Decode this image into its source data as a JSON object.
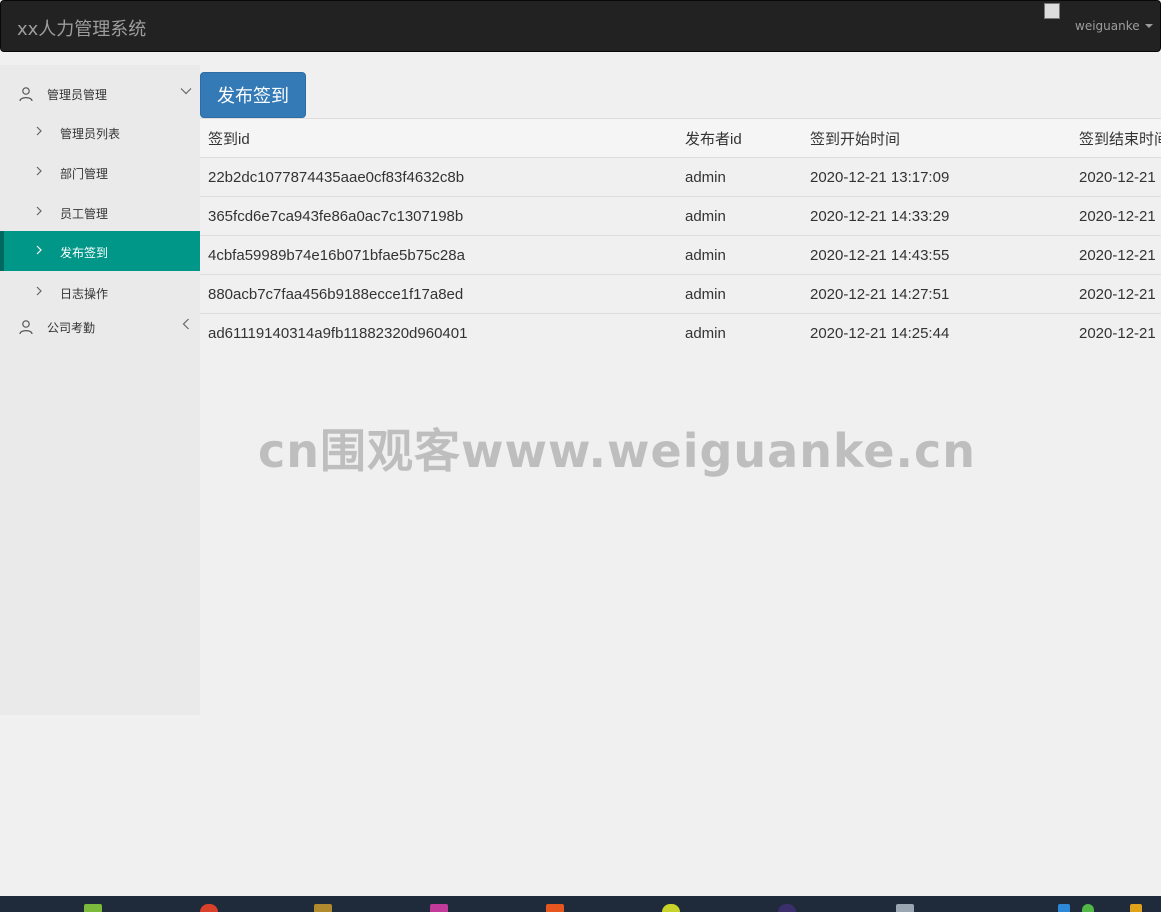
{
  "app": {
    "title": "xx人力管理系统",
    "username": "weiguanke"
  },
  "sidebar": {
    "groups": [
      {
        "label": "管理员管理",
        "items": [
          "管理员列表",
          "部门管理",
          "员工管理",
          "发布签到",
          "日志操作"
        ]
      },
      {
        "label": "公司考勤"
      }
    ],
    "active_item": "发布签到"
  },
  "toolbar": {
    "publish_label": "发布签到"
  },
  "table": {
    "headers": [
      "签到id",
      "发布者id",
      "签到开始时间",
      "签到结束时间"
    ],
    "rows": [
      [
        "22b2dc1077874435aae0cf83f4632c8b",
        "admin",
        "2020-12-21 13:17:09",
        "2020-12-21"
      ],
      [
        "365fcd6e7ca943fe86a0ac7c1307198b",
        "admin",
        "2020-12-21 14:33:29",
        "2020-12-21"
      ],
      [
        "4cbfa59989b74e16b071bfae5b75c28a",
        "admin",
        "2020-12-21 14:43:55",
        "2020-12-21"
      ],
      [
        "880acb7c7faa456b9188ecce1f17a8ed",
        "admin",
        "2020-12-21 14:27:51",
        "2020-12-21"
      ],
      [
        "ad61119140314a9fb11882320d960401",
        "admin",
        "2020-12-21 14:25:44",
        "2020-12-21"
      ]
    ]
  },
  "watermark": "cn围观客www.weiguanke.cn",
  "colors": {
    "navbar": "#222222",
    "accent": "#009688",
    "button": "#337ab7"
  }
}
